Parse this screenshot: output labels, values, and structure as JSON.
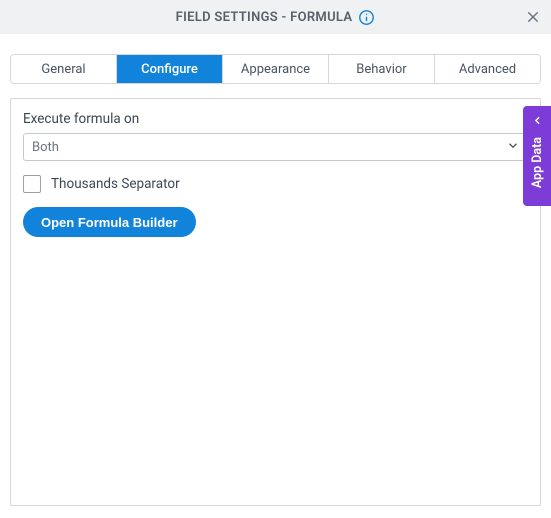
{
  "header": {
    "title": "FIELD SETTINGS - FORMULA"
  },
  "tabs": [
    {
      "label": "General",
      "active": false
    },
    {
      "label": "Configure",
      "active": true
    },
    {
      "label": "Appearance",
      "active": false
    },
    {
      "label": "Behavior",
      "active": false
    },
    {
      "label": "Advanced",
      "active": false
    }
  ],
  "configure": {
    "execute_label": "Execute formula on",
    "execute_value": "Both",
    "thousands_label": "Thousands Separator",
    "thousands_checked": false,
    "open_builder_label": "Open Formula Builder"
  },
  "side_panel": {
    "label": "App Data"
  },
  "colors": {
    "primary": "#1283da",
    "accent": "#7d3cd8"
  }
}
